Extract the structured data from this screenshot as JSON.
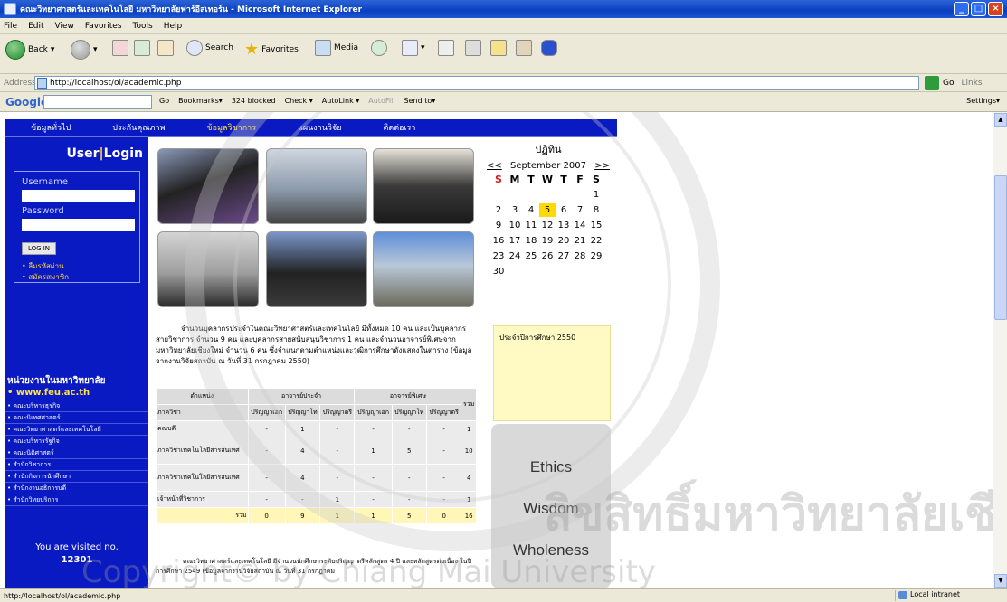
{
  "window": {
    "title": "คณะวิทยาศาสตร์และเทคโนโลยี มหาวิทยาลัยฟาร์อีสเทอร์น - Microsoft Internet Explorer"
  },
  "menu": [
    "File",
    "Edit",
    "View",
    "Favorites",
    "Tools",
    "Help"
  ],
  "toolbar": {
    "back": "Back",
    "search": "Search",
    "favorites": "Favorites",
    "media": "Media"
  },
  "address": {
    "label": "Address",
    "url": "http://localhost/ol/academic.php",
    "go": "Go",
    "links": "Links"
  },
  "googlebar": {
    "logo": "Google",
    "items": [
      "Go",
      "Bookmarks▾",
      "324 blocked",
      "Check ▾",
      "AutoLink ▾",
      "AutoFill",
      "Send to▾"
    ],
    "settings": "Settings▾"
  },
  "site": {
    "nav": [
      "ข้อมูลทั่วไป",
      "ประกันคุณภาพ",
      "ข้อมูลวิชาการ",
      "แผนงานวิจัย",
      "ติดต่อเรา"
    ],
    "login": {
      "user": "User",
      "sep": "|",
      "login": "Login",
      "username_label": "Username",
      "password_label": "Password",
      "button": "LOG IN",
      "link1": "ลืมรหัสผ่าน",
      "link2": "สมัครสมาชิก"
    },
    "departments_title": "หน่วยงานในมหาวิทยาลัย",
    "departments": [
      "www.feu.ac.th",
      "คณะบริหารธุรกิจ",
      "คณะนิเทศศาสตร์",
      "คณะวิทยาศาสตร์และเทคโนโลยี",
      "คณะบริหารรัฐกิจ",
      "คณะนิติศาสตร์",
      "สำนักวิชาการ",
      "สำนักกิจการนักศึกษา",
      "สำนักงานอธิการบดี",
      "สำนักวิทยบริการ"
    ],
    "visited_label": "You are visited no.",
    "visited_count": "12301",
    "intro": "จำนวนบุคลากรประจำในคณะวิทยาศาสตร์และเทคโนโลยี มีทั้งหมด 10 คน และเป็นบุคลากรสายวิชาการ จำนวน 9 คน และบุคลากรสายสนับสนุนวิชาการ 1 คน และจำนวนอาจารย์พิเศษจากมหาวิทยาลัยเชียงใหม่ จำนวน 6 คน ซึ่งจำแนกตามตำแหน่งและวุฒิการศึกษาดังแสดงในตาราง (ข้อมูลจากงานวิจัยสถาบัน ณ วันที่ 31 กรกฎาคม 2550)",
    "table": {
      "h_position": "ตำแหน่ง",
      "h_fulltime": "อาจารย์ประจำ",
      "h_special": "อาจารย์พิเศษ",
      "h_dept": "ภาควิชา",
      "sub": [
        "ปริญญาเอก",
        "ปริญญาโท",
        "ปริญญาตรี",
        "ปริญญาเอก",
        "ปริญญาโท",
        "ปริญญาตรี",
        "รวม"
      ],
      "rows": [
        {
          "name": "คณบดี",
          "v": [
            "-",
            "1",
            "-",
            "-",
            "-",
            "-",
            "1"
          ]
        },
        {
          "name": "ภาควิชาเทคโนโลยีสารสนเทศ",
          "v": [
            "-",
            "4",
            "-",
            "1",
            "5",
            "-",
            "10"
          ]
        },
        {
          "name": "ภาควิชาเทคโนโลยีสารสนเทศ",
          "v": [
            "-",
            "4",
            "-",
            "-",
            "-",
            "-",
            "4"
          ]
        },
        {
          "name": "เจ้าหน้าที่วิชาการ",
          "v": [
            "-",
            "-",
            "1",
            "-",
            "-",
            "-",
            "1"
          ]
        }
      ],
      "total": {
        "name": "รวม",
        "v": [
          "0",
          "9",
          "1",
          "1",
          "5",
          "0",
          "16"
        ]
      }
    },
    "calendar": {
      "title": "ปฏิทิน",
      "prev": "<<",
      "next": ">>",
      "month": "September 2007",
      "weekdays": [
        "S",
        "M",
        "T",
        "W",
        "T",
        "F",
        "S"
      ],
      "weeks": [
        [
          "",
          "",
          "",
          "",
          "",
          "",
          "1"
        ],
        [
          "2",
          "3",
          "4",
          "5",
          "6",
          "7",
          "8"
        ],
        [
          "9",
          "10",
          "11",
          "12",
          "13",
          "14",
          "15"
        ],
        [
          "16",
          "17",
          "18",
          "19",
          "20",
          "21",
          "22"
        ],
        [
          "23",
          "24",
          "25",
          "26",
          "27",
          "28",
          "29"
        ],
        [
          "30",
          "",
          "",
          "",
          "",
          "",
          ""
        ]
      ],
      "today": "5"
    },
    "year_note": "ประจำปีการศึกษา 2550",
    "values": [
      "Ethics",
      "Wisdom",
      "Wholeness"
    ],
    "bottom": "คณะวิทยาศาสตร์และเทคโนโลยี มีจำนวนนักศึกษาระดับปริญญาตรีหลักสูตร 4 ปี และหลักสูตรต่อเนื่อง ในปีการศึกษา 2549 (ข้อมูลจากงานวิจัยสถาบัน ณ วันที่ 31 กรกฎาคม"
  },
  "status": {
    "text": "http://localhost/ol/academic.php",
    "zone": "Local intranet"
  },
  "watermark": {
    "text1": "ลิขสิทธิ์มหาวิทยาลัยเชียงใหม่",
    "text2": "Copyright© by Chiang Mai University"
  }
}
